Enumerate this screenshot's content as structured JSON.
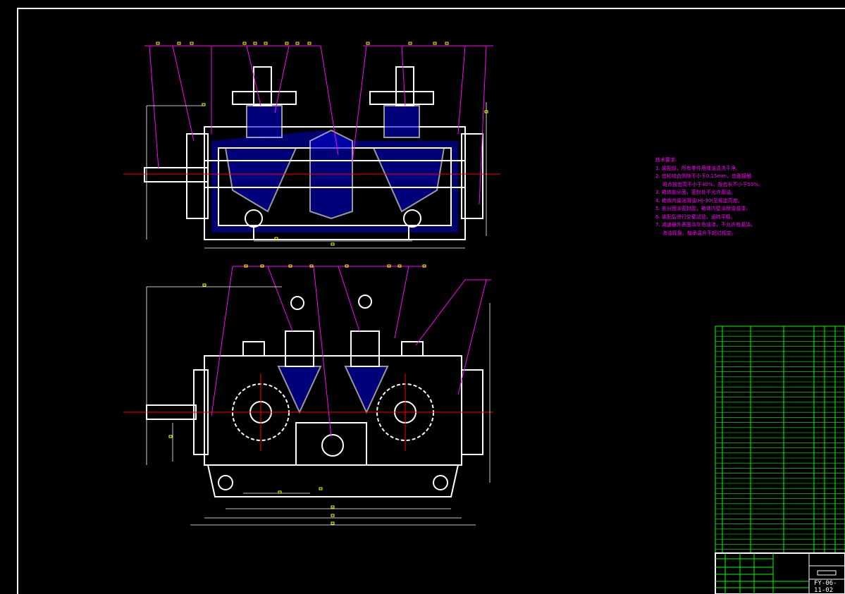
{
  "colors": {
    "background": "#000000",
    "outline": "#ffffff",
    "section_hatch": "#0000ff",
    "leaders": "#ff00ff",
    "labels": "#ffff00",
    "table": "#00ff00",
    "centerline": "#ff0000"
  },
  "technical_requirements": {
    "title": "技术要求:",
    "items": [
      "1. 装配前，所有零件用煤油清洗干净。",
      "2. 齿轮啮合侧隙不小于0.15mm，齿面接触",
      "   斑点按齿高不小于40%，按齿长不小于50%。",
      "3. 箱体剖分面，密封处不允许漏油。",
      "4. 箱体内装润滑油(HJ-30)至规定高度。",
      "5. 剖分面涂密封胶，箱体内壁涂耐油油漆。",
      "6. 装配后进行空载试验，运转平稳。",
      "7. 减速器外表面涂灰色油漆，不允许有漏油，",
      "   渗油现象，轴承温升不超过规定。"
    ]
  },
  "title_block": {
    "drawing_number": "FY-06-11-02"
  }
}
